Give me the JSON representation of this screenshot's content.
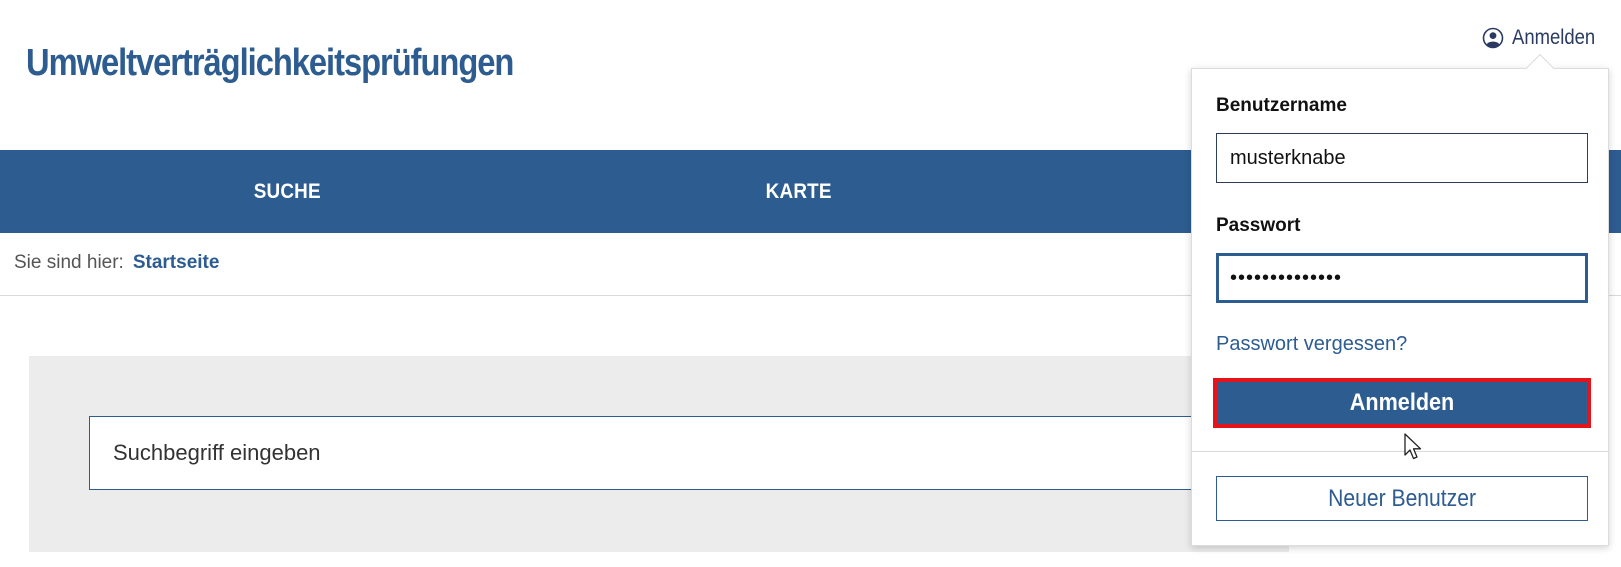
{
  "header": {
    "site_title": "Umweltverträglichkeitsprüfungen",
    "login_toggle_label": "Anmelden"
  },
  "nav": {
    "items": [
      {
        "label": "SUCHE"
      },
      {
        "label": "KARTE"
      }
    ]
  },
  "breadcrumb": {
    "prefix": "Sie sind hier:",
    "current": "Startseite"
  },
  "search": {
    "placeholder": "Suchbegriff eingeben"
  },
  "login_form": {
    "username_label": "Benutzername",
    "username_value": "musterknabe",
    "password_label": "Passwort",
    "password_value": "••••••••••••••",
    "forgot_link": "Passwort vergessen?",
    "submit_label": "Anmelden",
    "register_label": "Neuer Benutzer"
  },
  "colors": {
    "brand_blue": "#2d5c91",
    "highlight_red": "#e5141b",
    "panel_gray": "#ececec"
  },
  "icons": {
    "login_toggle": "user-circle-icon",
    "pointer": "mouse-cursor-icon"
  }
}
